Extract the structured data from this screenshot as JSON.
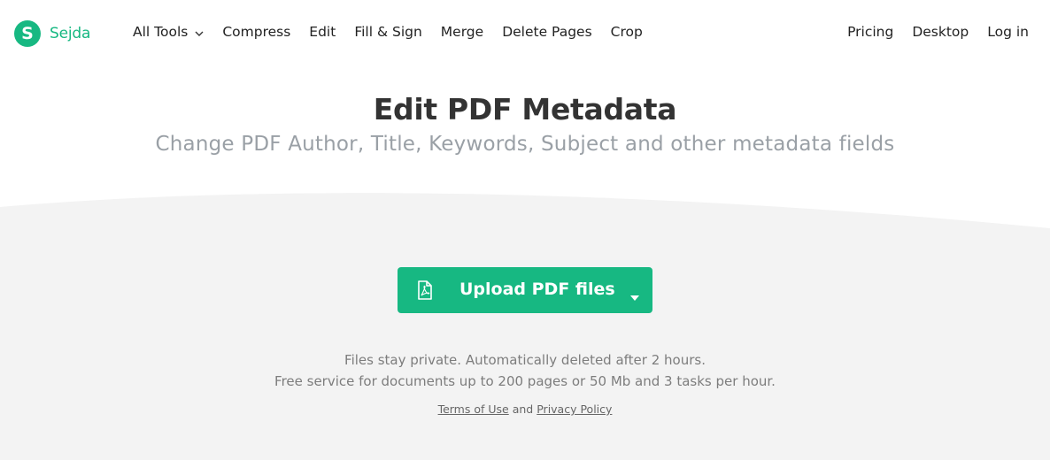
{
  "brand": {
    "name": "Sejda",
    "mark": "S"
  },
  "nav": {
    "left": [
      {
        "label": "All Tools",
        "has_dropdown": true
      },
      {
        "label": "Compress"
      },
      {
        "label": "Edit"
      },
      {
        "label": "Fill & Sign"
      },
      {
        "label": "Merge"
      },
      {
        "label": "Delete Pages"
      },
      {
        "label": "Crop"
      }
    ],
    "right": [
      {
        "label": "Pricing"
      },
      {
        "label": "Desktop"
      },
      {
        "label": "Log in"
      }
    ]
  },
  "hero": {
    "title": "Edit PDF Metadata",
    "subtitle": "Change PDF Author, Title, Keywords, Subject and other metadata fields"
  },
  "upload": {
    "label": "Upload PDF files",
    "icon": "pdf-file-icon"
  },
  "info": {
    "privacy": "Files stay private. Automatically deleted after 2 hours.",
    "limits": "Free service for documents up to 200 pages or 50 Mb and 3 tasks per hour."
  },
  "legal": {
    "terms": "Terms of Use",
    "and": "and",
    "privacy": "Privacy Policy"
  },
  "colors": {
    "brand_green": "#17b882",
    "panel_gray": "#f3f3f3"
  }
}
